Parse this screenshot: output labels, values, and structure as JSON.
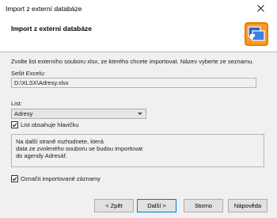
{
  "window": {
    "title": "Import z externí databáze"
  },
  "header": {
    "title": "Import z externí databáze"
  },
  "instruction": "Zvolte list externího souboru xlsx, ze kterého chcete importovat. Název vyberte ze seznamu.",
  "excel": {
    "label": "Sešit Excelu:",
    "value": "D:\\XLSX\\Adresy.xlsx"
  },
  "sheet": {
    "label": "List:",
    "selected": "Adresy"
  },
  "header_checkbox": {
    "label": "List obsahuje hlavičku",
    "checked": true
  },
  "info_lines": [
    "Na další straně rozhodnete, která",
    "data ze zvoleného souboru se budou importovat",
    "do agendy Adresář."
  ],
  "mark_checkbox": {
    "label": "Označit importované záznamy",
    "checked": true
  },
  "buttons": {
    "back": "< Zpět",
    "next": "Další >",
    "cancel": "Storno",
    "help": "Nápověda"
  },
  "colors": {
    "accent": "#0078d7",
    "logo_orange": "#f07d00"
  },
  "icons": {
    "close": "close-icon",
    "logo": "import-database-logo-icon",
    "check": "checkmark-icon",
    "dropdown": "chevron-down-icon"
  }
}
